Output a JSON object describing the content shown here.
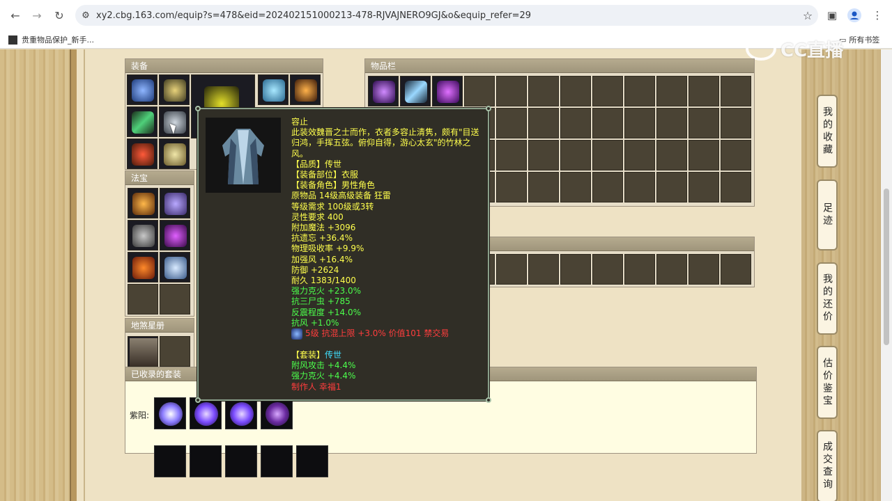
{
  "browser": {
    "url": "xy2.cbg.163.com/equip?s=478&eid=202402151000213-478-RJVAJNERO9GJ&o&equip_refer=29",
    "bookmark_label": "贵重物品保护_新手...",
    "all_bookmarks": "所有书签"
  },
  "watermark": "CC直播",
  "panels": {
    "equipment": "装备",
    "magic_items": "法宝",
    "earth_register": "地煞星册",
    "inventory": "物品栏",
    "collected_sets": "已收录的套装"
  },
  "tooltip": {
    "name": "容止",
    "description": "此装效魏晋之士而作，衣者多容止清隽，颇有\"目送归鸿，手挥五弦。俯仰自得，游心太玄\"的竹林之风。",
    "quality": "【品质】传世",
    "slot": "【装备部位】衣服",
    "role": "【装备角色】男性角色",
    "origin": "原物品 14级高级装备 狂雷",
    "level_req": "等级需求 100级或3转",
    "spirit_req": "灵性要求 400",
    "stats_yellow": [
      "附加魔法 +3096",
      "抗遗忘 +36.4%",
      "物理吸收率 +9.9%",
      "加强风 +16.4%",
      "防御 +2624",
      "耐久 1383/1400"
    ],
    "stats_green": [
      "强力克火 +23.0%",
      "抗三尸虫 +785",
      "反震程度 +14.0%",
      "抗风 +1.0%"
    ],
    "gem_line": "5级 抗混上限 +3.0% 价值101 禁交易",
    "set_label": "【套装】",
    "set_name": "传世",
    "set_stats": [
      "附风攻击 +4.4%",
      "强力克火 +4.4%"
    ],
    "maker": "制作人 幸福1"
  },
  "sets": {
    "row_label": "紫阳:"
  },
  "side_tabs": [
    "我的收藏",
    "足迹",
    "我的还价",
    "估价鉴宝",
    "成交查询"
  ]
}
